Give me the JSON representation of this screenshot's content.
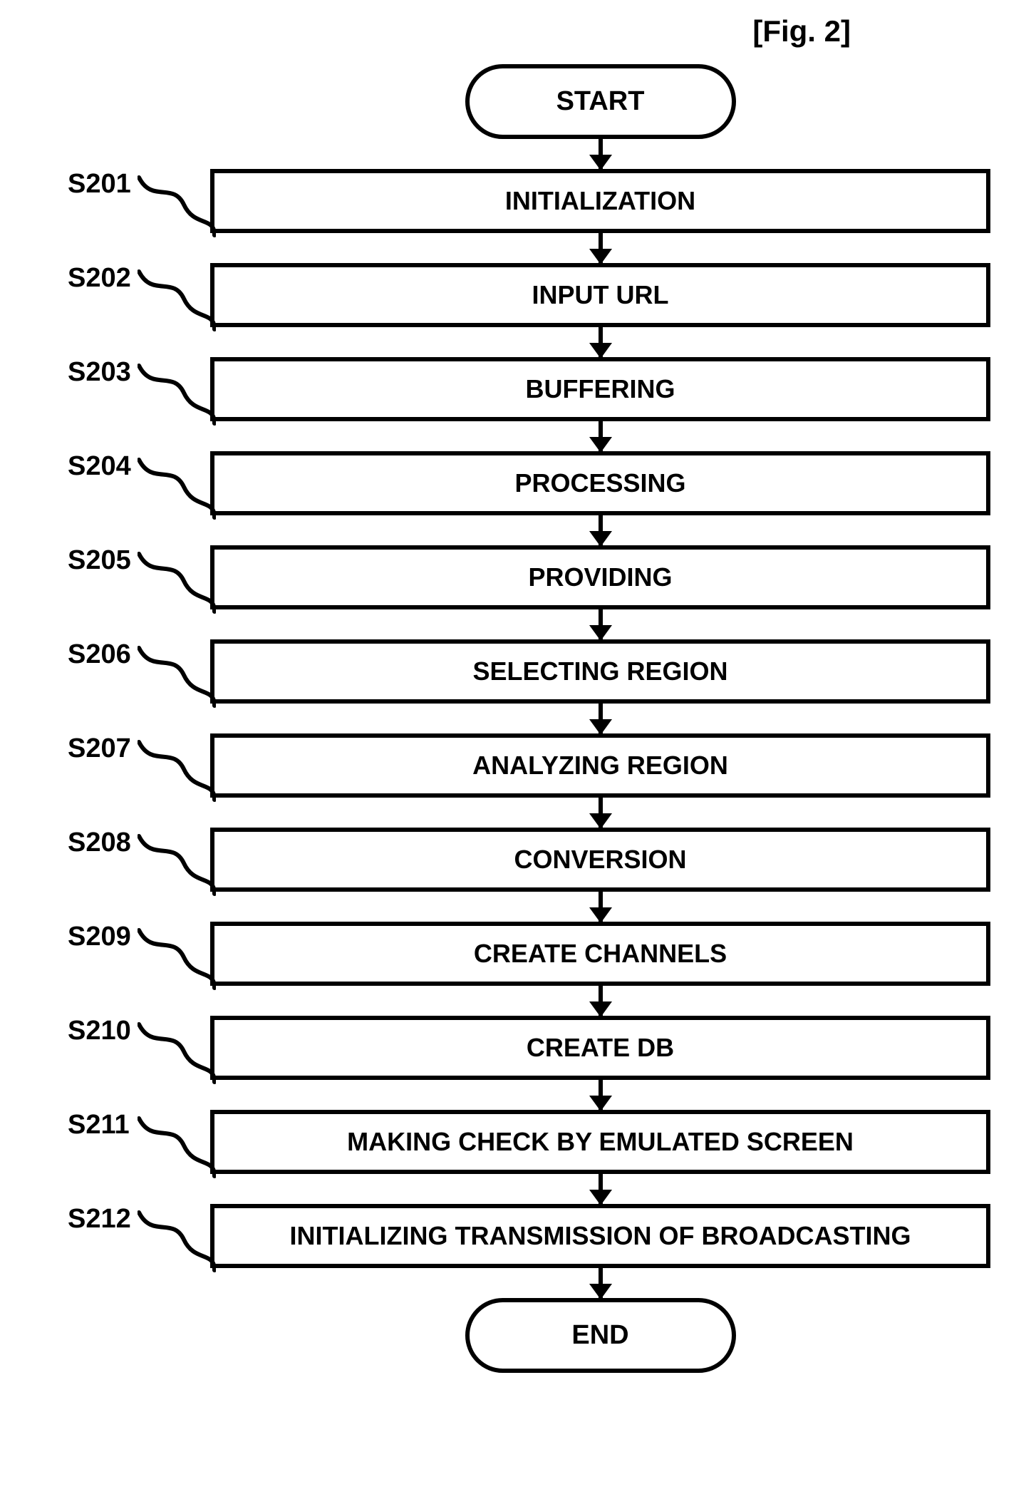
{
  "figure_label": "[Fig. 2]",
  "start_label": "START",
  "end_label": "END",
  "steps": [
    {
      "id": "S201",
      "text": "INITIALIZATION"
    },
    {
      "id": "S202",
      "text": "INPUT URL"
    },
    {
      "id": "S203",
      "text": "BUFFERING"
    },
    {
      "id": "S204",
      "text": "PROCESSING"
    },
    {
      "id": "S205",
      "text": "PROVIDING"
    },
    {
      "id": "S206",
      "text": "SELECTING REGION"
    },
    {
      "id": "S207",
      "text": "ANALYZING REGION"
    },
    {
      "id": "S208",
      "text": "CONVERSION"
    },
    {
      "id": "S209",
      "text": "CREATE CHANNELS"
    },
    {
      "id": "S210",
      "text": "CREATE DB"
    },
    {
      "id": "S211",
      "text": "MAKING CHECK BY EMULATED SCREEN"
    },
    {
      "id": "S212",
      "text": "INITIALIZING TRANSMISSION OF BROADCASTING"
    }
  ]
}
